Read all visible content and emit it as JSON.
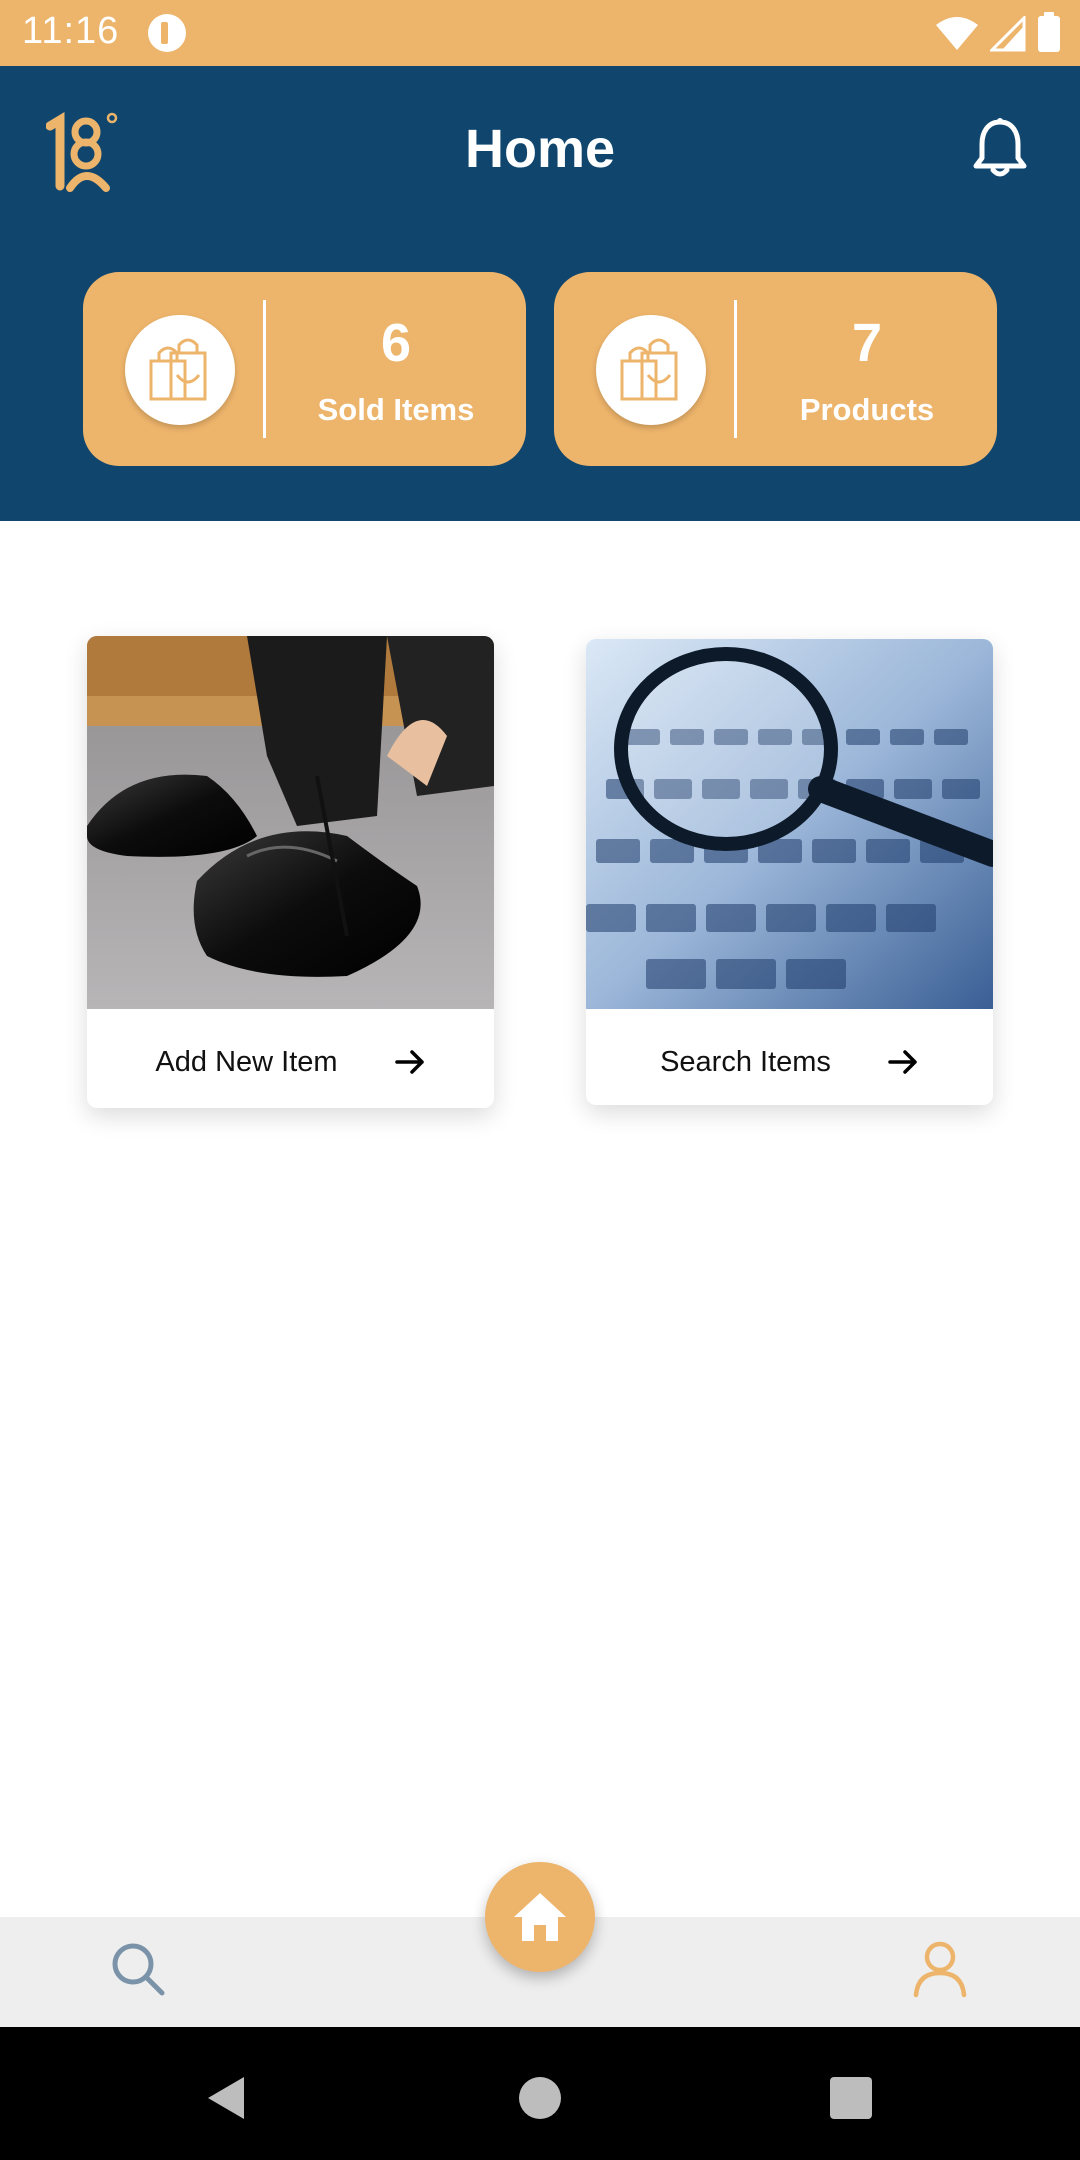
{
  "status_bar": {
    "time": "11:16",
    "icons": [
      "app-notification-icon",
      "wifi-icon",
      "signal-icon",
      "battery-icon"
    ]
  },
  "header": {
    "logo_icon": "brand-logo",
    "title": "Home",
    "bell_icon": "bell-icon"
  },
  "stats": [
    {
      "value": "6",
      "label": "Sold Items",
      "icon": "shopping-bags-icon"
    },
    {
      "value": "7",
      "label": "Products",
      "icon": "shopping-bags-icon"
    }
  ],
  "cards": [
    {
      "label": "Add New Item",
      "image": "shoes-photo",
      "icon": "arrow-right-icon"
    },
    {
      "label": "Search Items",
      "image": "magnifier-keyboard-photo",
      "icon": "arrow-right-icon"
    }
  ],
  "bottom_nav": {
    "items": [
      {
        "icon": "search-icon"
      },
      {
        "icon": "home-icon",
        "active": true
      },
      {
        "icon": "profile-icon"
      }
    ]
  },
  "colors": {
    "accent": "#EDB46B",
    "header": "#10466D",
    "nav_bg": "#EEEEEE"
  }
}
